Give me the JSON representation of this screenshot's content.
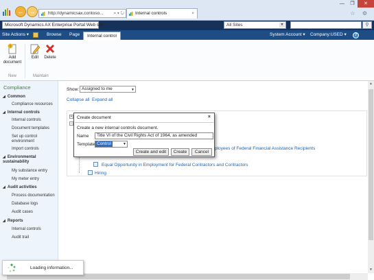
{
  "browser": {
    "address": "http://dynamicsax.contoso...",
    "address_tools": "⌕ ▾ ↻",
    "tab_title": "Internal controls",
    "tab_close": "×",
    "window_minimize": "—",
    "window_maximize": "❐",
    "window_close": "✕",
    "toolbar_icons": "☆ ⚙"
  },
  "sp_top": {
    "site_title": "Microsoft Dynamics AX Enterprise Portal Web site",
    "scope": "All Sites",
    "search_placeholder": "",
    "search_icon": "search-icon"
  },
  "ribbon_tabs": {
    "site_actions": "Site Actions ▾",
    "browse": "Browse",
    "page": "Page",
    "internal_control": "Internal control",
    "system_account": "System Account ▾",
    "company": "Company:USED ▾",
    "help": "?"
  },
  "ribbon": {
    "add_document": "Add document",
    "edit": "Edit",
    "delete": "Delete",
    "group_new": "New",
    "group_maintain": "Maintain"
  },
  "quick_launch": {
    "title": "Compliance",
    "sections": [
      {
        "label": "Common",
        "items": [
          "Compliance resources"
        ]
      },
      {
        "label": "Internal controls",
        "items": [
          "Internal controls",
          "Document templates",
          "Set up control environment",
          "Import controls"
        ]
      },
      {
        "label": "Environmental sustainability",
        "items": [
          "My substance entry",
          "My meter entry"
        ]
      },
      {
        "label": "Audit activities",
        "items": [
          "Process documentation",
          "Database logs",
          "Audit cases"
        ]
      },
      {
        "label": "Reports",
        "items": [
          "Internal controls",
          "Audit trail"
        ]
      }
    ]
  },
  "main": {
    "show_label": "Show:",
    "show_value": "Assigned to me",
    "collapse_all": "Collapse all",
    "expand_all": "Expand all",
    "tree": {
      "item_partial": "ployees of Federal Financial Assistance Recipients",
      "item_equal_opportunity": "Equal Opportunity in Employment for Federal Contractors and Contractors",
      "item_hiring": "Hiring"
    }
  },
  "dialog": {
    "title": "Create document",
    "close": "×",
    "description": "Create a new internal controls document.",
    "name_label": "Name",
    "name_value": "Title VI of the Civil Rights Act of 1964, as amended",
    "template_label": "Template",
    "template_value": "Control",
    "btn_create_edit": "Create and edit",
    "btn_create": "Create",
    "btn_cancel": "Cancel"
  },
  "loading": {
    "text": "Loading information..."
  },
  "colors": {
    "sp_top_bar": "#17325a",
    "ribbon_tab_bar": "#1e4d86",
    "link": "#1d64b8",
    "compliance_green": "#2a8d2a"
  }
}
